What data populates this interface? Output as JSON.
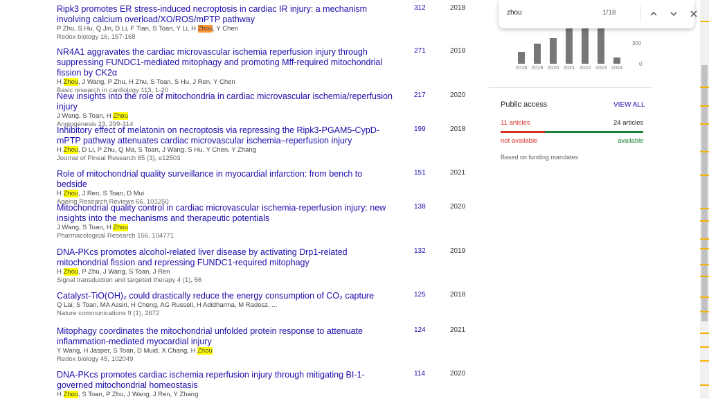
{
  "find_bar": {
    "query": "zhou",
    "count": "1/18"
  },
  "articles": [
    {
      "title": "Ripk3 promotes ER stress-induced necroptosis in cardiac IR injury: a mechanism involving calcium overload/XO/ROS/mPTP pathway",
      "authors_pre": "P Zhu, S Hu, Q Jin, D Li, F Tian, S Toan, Y Li, H ",
      "highlight": "Zhou",
      "authors_post": ", Y Chen",
      "venue": "Redox biology 16, 157-168",
      "cited": "312",
      "year": "2018"
    },
    {
      "title": "NR4A1 aggravates the cardiac microvascular ischemia reperfusion injury through suppressing FUNDC1-mediated mitophagy and promoting Mff-required mitochondrial fission by CK2α",
      "authors_pre": "H ",
      "highlight": "Zhou",
      "authors_post": ", J Wang, P Zhu, H Zhu, S Toan, S Hu, J Ren, Y Chen",
      "venue": "Basic research in cardiology 113, 1-20",
      "cited": "271",
      "year": "2018"
    },
    {
      "title": "New insights into the role of mitochondria in cardiac microvascular ischemia/reperfusion injury",
      "authors_pre": "J Wang, S Toan, H ",
      "highlight": "Zhou",
      "authors_post": "",
      "venue": "Angiogenesis 23, 299-314",
      "cited": "217",
      "year": "2020"
    },
    {
      "title": "Inhibitory effect of melatonin on necroptosis via repressing the Ripk3-PGAM5-CypD-mPTP pathway attenuates cardiac microvascular ischemia–reperfusion injury",
      "authors_pre": "H ",
      "highlight": "Zhou",
      "authors_post": ", D Li, P Zhu, Q Ma, S Toan, J Wang, S Hu, Y Chen, Y Zhang",
      "venue": "Journal of Pineal Research 65 (3), e12503",
      "cited": "199",
      "year": "2018"
    },
    {
      "title": "Role of mitochondrial quality surveillance in myocardial infarction: from bench to bedside",
      "authors_pre": "H ",
      "highlight": "Zhou",
      "authors_post": ", J Ren, S Toan, D Mui",
      "venue": "Ageing Research Reviews 66, 101250",
      "cited": "151",
      "year": "2021"
    },
    {
      "title": "Mitochondrial quality control in cardiac microvascular ischemia-reperfusion injury: new insights into the mechanisms and therapeutic potentials",
      "authors_pre": "J Wang, S Toan, H ",
      "highlight": "Zhou",
      "authors_post": "",
      "venue": "Pharmacological Research 156, 104771",
      "cited": "138",
      "year": "2020"
    },
    {
      "title": "DNA-PKcs promotes alcohol-related liver disease by activating Drp1-related mitochondrial fission and repressing FUNDC1-required mitophagy",
      "authors_pre": "H ",
      "highlight": "Zhou",
      "authors_post": ", P Zhu, J Wang, S Toan, J Ren",
      "venue": "Signal transduction and targeted therapy 4 (1), 56",
      "cited": "132",
      "year": "2019"
    },
    {
      "title": "Catalyst-TiO(OH)₂ could drastically reduce the energy consumption of CO₂ capture",
      "authors_pre": "Q Lai, S Toan, MA Assiri, H Cheng, AG Russell, H Adidharma, M Radosz, ...",
      "highlight": "",
      "authors_post": "",
      "venue": "Nature communications 9 (1), 2672",
      "cited": "125",
      "year": "2018"
    },
    {
      "title": "Mitophagy coordinates the mitochondrial unfolded protein response to attenuate inflammation-mediated myocardial injury",
      "authors_pre": "Y Wang, H Jasper, S Toan, D Muid, X Chang, H ",
      "highlight": "Zhou",
      "authors_post": "",
      "venue": "Redox biology 45, 102049",
      "cited": "124",
      "year": "2021"
    },
    {
      "title": "DNA-PKcs promotes cardiac ischemia reperfusion injury through mitigating BI-1-governed mitochondrial homeostasis",
      "authors_pre": "H ",
      "highlight": "Zhou",
      "authors_post": ", S Toan, P Zhu, J Wang, J Ren, Y Zhang",
      "venue": "",
      "cited": "114",
      "year": "2020"
    }
  ],
  "chart": {
    "years": [
      "2018",
      "2019",
      "2020",
      "2021",
      "2022",
      "2023",
      "2024"
    ],
    "values": [
      170,
      280,
      360,
      600,
      600,
      560,
      90
    ],
    "ymax": 700,
    "yticks": [
      "300",
      "0"
    ]
  },
  "public_access": {
    "title": "Public access",
    "view_all": "VIEW ALL",
    "not_available_count": "11 articles",
    "available_count": "24 articles",
    "not_available_label": "not available",
    "available_label": "available",
    "note": "Based on funding mandates",
    "colors": {
      "not_available": "#d93025",
      "available": "#188038"
    }
  }
}
